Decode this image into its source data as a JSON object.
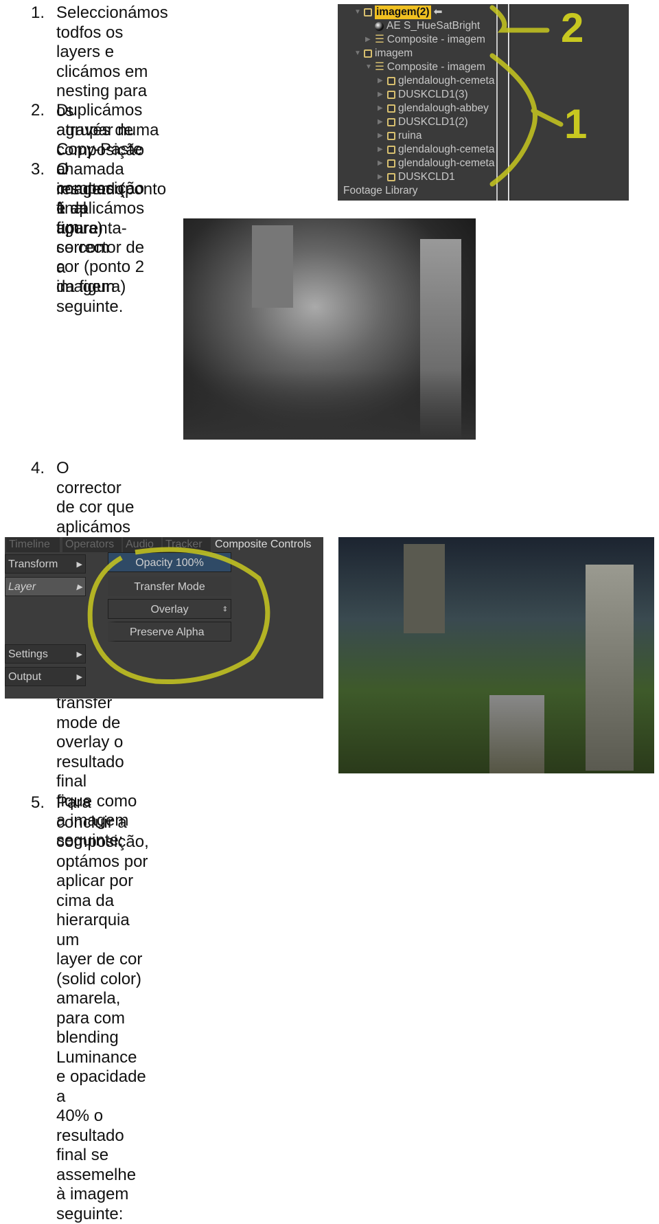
{
  "items": [
    {
      "num": "1.",
      "lines": [
        "Seleccionámos todfos os layers e",
        "clicámos em nesting para os",
        "agrupar numa composição",
        "chamada imagem (ponto 1 da",
        "figura)"
      ]
    },
    {
      "num": "2.",
      "lines": [
        "Duplicámos através de Copy-Paste",
        "a composição e aplicámos um",
        "corrector de cor (ponto 2 da figura)"
      ]
    },
    {
      "num": "3.",
      "lines": [
        "O resultado final aparenta-se com",
        "a imagem seguinte."
      ]
    },
    {
      "num": "4.",
      "lines": [
        "O corrector de cor que aplicámos visa retirar toda informação de cor da",
        "imagem, para que através de um transfer mode de overlay o resultado final",
        "fique como a imagem seguinte:"
      ]
    },
    {
      "num": "5.",
      "lines": [
        "Para concluir a composição, optámos por aplicar por cima da hierarquia um",
        "layer de cor (solid color) amarela, para com blending Luminance e opacidade a",
        "40% o resultado final se assemelhe à imagem seguinte:"
      ]
    }
  ],
  "tree": {
    "rows": [
      "imagem(2)",
      "AE S_HueSatBright",
      "Composite - imagem",
      "imagem",
      "Composite - imagem",
      "glendalough-cemeta",
      "DUSKCLD1(3)",
      "glendalough-abbey",
      "DUSKCLD1(2)",
      "ruina",
      "glendalough-cemeta",
      "glendalough-cemeta",
      "DUSKCLD1"
    ],
    "footer": "Footage Library",
    "annotations": [
      "2",
      "1"
    ],
    "highlight_color": "#f0c020"
  },
  "controls": {
    "tabs": [
      "Timeline",
      "Operators",
      "Audio",
      "Tracker",
      "Composite Controls"
    ],
    "side": [
      "Transform",
      "Layer",
      "Settings",
      "Output"
    ],
    "opacity": "Opacity 100%",
    "transfer_label": "Transfer Mode",
    "transfer_value": "Overlay",
    "preserve": "Preserve Alpha",
    "annotation_color": "#c8c820"
  }
}
